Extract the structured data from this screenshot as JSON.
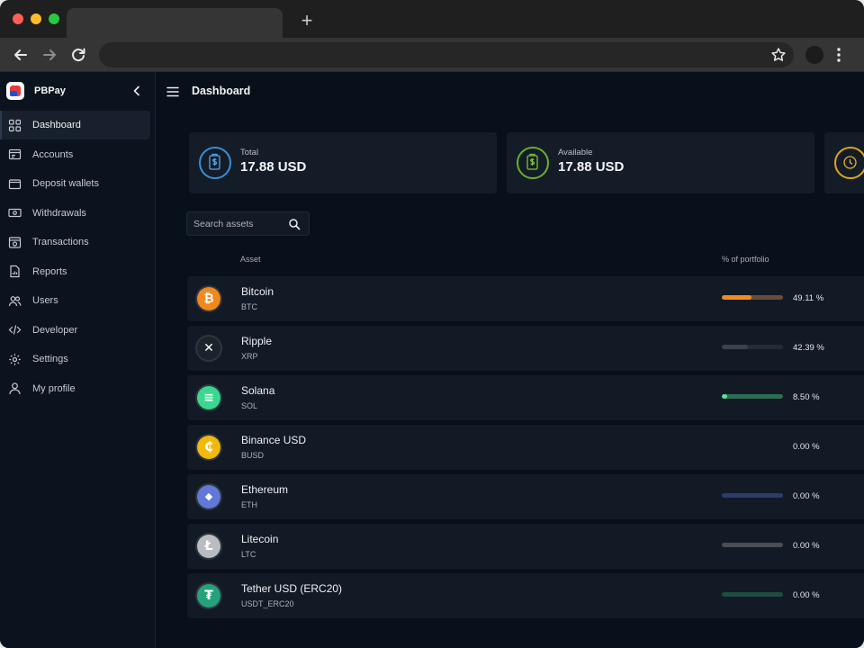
{
  "app": {
    "brand": "PBPay",
    "page_title": "Dashboard"
  },
  "sidebar": {
    "items": [
      {
        "label": "Dashboard",
        "icon": "grid-icon",
        "active": true
      },
      {
        "label": "Accounts",
        "icon": "accounts-icon",
        "active": false
      },
      {
        "label": "Deposit wallets",
        "icon": "wallet-icon",
        "active": false
      },
      {
        "label": "Withdrawals",
        "icon": "cash-icon",
        "active": false
      },
      {
        "label": "Transactions",
        "icon": "transactions-icon",
        "active": false
      },
      {
        "label": "Reports",
        "icon": "report-icon",
        "active": false
      },
      {
        "label": "Users",
        "icon": "users-icon",
        "active": false
      },
      {
        "label": "Developer",
        "icon": "code-icon",
        "active": false
      },
      {
        "label": "Settings",
        "icon": "gear-icon",
        "active": false
      },
      {
        "label": "My profile",
        "icon": "user-icon",
        "active": false
      }
    ]
  },
  "summary": [
    {
      "label": "Total",
      "value": "17.88 USD",
      "color": "#3a8fd6"
    },
    {
      "label": "Available",
      "value": "17.88 USD",
      "color": "#69b02a"
    },
    {
      "label": "",
      "value": "",
      "color": "#e0a51c"
    }
  ],
  "search": {
    "placeholder": "Search assets",
    "value": ""
  },
  "table": {
    "headers": {
      "asset": "Asset",
      "portfolio": "% of portfolio"
    },
    "rows": [
      {
        "name": "Bitcoin",
        "symbol": "BTC",
        "percent": "49.11 %",
        "share": 0.4911,
        "coin_color": "#f1881b",
        "bar_color": "#f28c1e",
        "track_color": "#6a4c36",
        "glyph": "₿"
      },
      {
        "name": "Ripple",
        "symbol": "XRP",
        "percent": "42.39 %",
        "share": 0.4239,
        "coin_color": "#1c232c",
        "bar_color": "#3c424b",
        "track_color": "#262c35",
        "glyph": "✕"
      },
      {
        "name": "Solana",
        "symbol": "SOL",
        "percent": "8.50 %",
        "share": 0.085,
        "coin_color": "#38d98e",
        "bar_color": "#55e39c",
        "track_color": "#2f6d52",
        "glyph": "≡"
      },
      {
        "name": "Binance USD",
        "symbol": "BUSD",
        "percent": "0.00 %",
        "share": 0,
        "coin_color": "#f0b90b",
        "bar_color": "#121a26",
        "track_color": "#121a26",
        "glyph": "₵"
      },
      {
        "name": "Ethereum",
        "symbol": "ETH",
        "percent": "0.00 %",
        "share": 0,
        "coin_color": "#6278d8",
        "bar_color": "#334a85",
        "track_color": "#2a3d6e",
        "glyph": "◆"
      },
      {
        "name": "Litecoin",
        "symbol": "LTC",
        "percent": "0.00 %",
        "share": 0,
        "coin_color": "#b9bcc2",
        "bar_color": "#52565d",
        "track_color": "#4a4e55",
        "glyph": "Ł"
      },
      {
        "name": "Tether USD (ERC20)",
        "symbol": "USDT_ERC20",
        "percent": "0.00 %",
        "share": 0,
        "coin_color": "#26a17b",
        "bar_color": "#1e4d40",
        "track_color": "#1e4d40",
        "glyph": "₮"
      }
    ]
  }
}
